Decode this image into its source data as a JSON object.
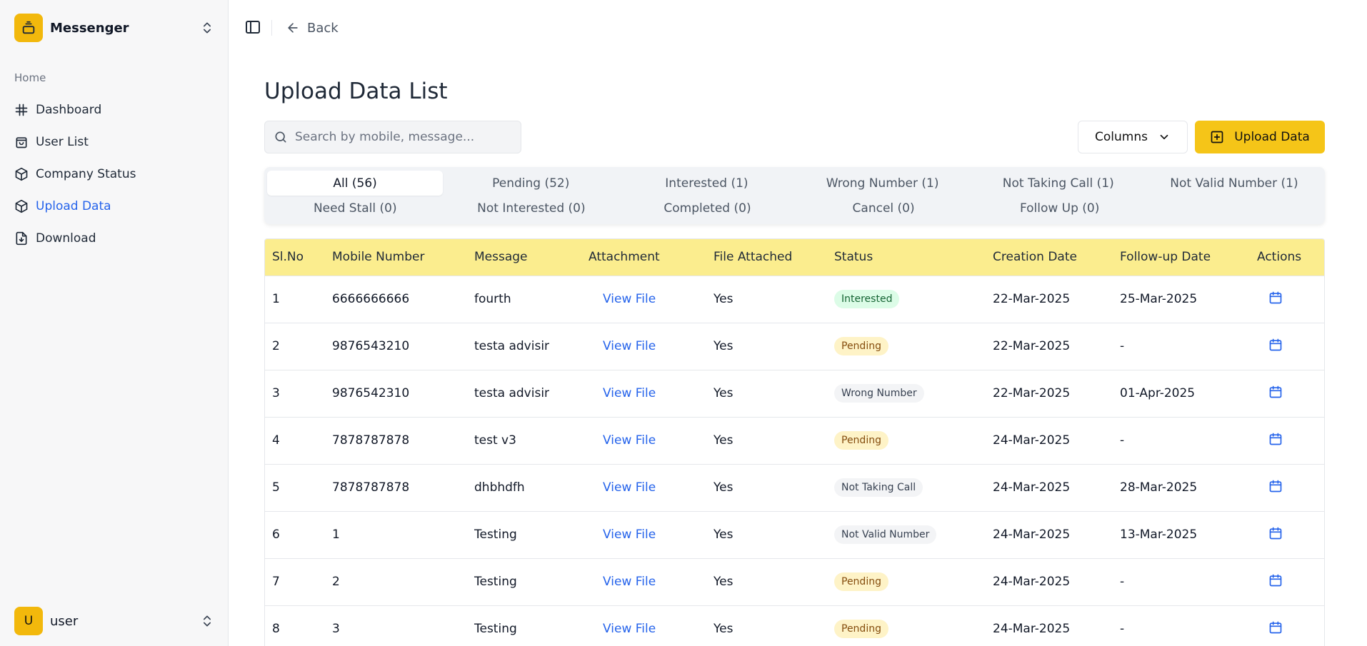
{
  "sidebar": {
    "app_name": "Messenger",
    "group_label": "Home",
    "items": [
      {
        "label": "Dashboard",
        "icon": "hash-icon"
      },
      {
        "label": "User List",
        "icon": "shopping-bag-icon"
      },
      {
        "label": "Company Status",
        "icon": "cube-icon"
      },
      {
        "label": "Upload Data",
        "icon": "cube-icon",
        "active": true
      },
      {
        "label": "Download",
        "icon": "file-download-icon"
      }
    ],
    "user": {
      "initial": "U",
      "name": "user"
    }
  },
  "topbar": {
    "back_label": "Back"
  },
  "page": {
    "title": "Upload Data List"
  },
  "search": {
    "placeholder": "Search by mobile, message..."
  },
  "toolbar": {
    "columns_label": "Columns",
    "upload_label": "Upload Data"
  },
  "tabs": [
    "All (56)",
    "Pending (52)",
    "Interested (1)",
    "Wrong Number (1)",
    "Not Taking Call (1)",
    "Not Valid Number (1)",
    "Need Stall (0)",
    "Not Interested (0)",
    "Completed (0)",
    "Cancel (0)",
    "Follow Up (0)"
  ],
  "table": {
    "headers": [
      "Sl.No",
      "Mobile Number",
      "Message",
      "Attachment",
      "File Attached",
      "Status",
      "Creation Date",
      "Follow-up Date",
      "Actions"
    ],
    "rows": [
      {
        "sl": "1",
        "mobile": "6666666666",
        "message": "fourth",
        "attachment": "View File",
        "file": "Yes",
        "status": "Interested",
        "created": "22-Mar-2025",
        "followup": "25-Mar-2025"
      },
      {
        "sl": "2",
        "mobile": "9876543210",
        "message": "testa advisir",
        "attachment": "View File",
        "file": "Yes",
        "status": "Pending",
        "created": "22-Mar-2025",
        "followup": "-"
      },
      {
        "sl": "3",
        "mobile": "9876542310",
        "message": "testa advisir",
        "attachment": "View File",
        "file": "Yes",
        "status": "Wrong Number",
        "created": "22-Mar-2025",
        "followup": "01-Apr-2025"
      },
      {
        "sl": "4",
        "mobile": "7878787878",
        "message": "test v3",
        "attachment": "View File",
        "file": "Yes",
        "status": "Pending",
        "created": "24-Mar-2025",
        "followup": "-"
      },
      {
        "sl": "5",
        "mobile": "7878787878",
        "message": "dhbhdfh",
        "attachment": "View File",
        "file": "Yes",
        "status": "Not Taking Call",
        "created": "24-Mar-2025",
        "followup": "28-Mar-2025"
      },
      {
        "sl": "6",
        "mobile": "1",
        "message": "Testing",
        "attachment": "View File",
        "file": "Yes",
        "status": "Not Valid Number",
        "created": "24-Mar-2025",
        "followup": "13-Mar-2025"
      },
      {
        "sl": "7",
        "mobile": "2",
        "message": "Testing",
        "attachment": "View File",
        "file": "Yes",
        "status": "Pending",
        "created": "24-Mar-2025",
        "followup": "-"
      },
      {
        "sl": "8",
        "mobile": "3",
        "message": "Testing",
        "attachment": "View File",
        "file": "Yes",
        "status": "Pending",
        "created": "24-Mar-2025",
        "followup": "-"
      }
    ]
  },
  "status_colors": {
    "Interested": {
      "bg": "#dcfce7",
      "fg": "#166534"
    },
    "Pending": {
      "bg": "#fef3c7",
      "fg": "#854d0e"
    },
    "Wrong Number": {
      "bg": "#f3f4f6",
      "fg": "#374151"
    },
    "Not Taking Call": {
      "bg": "#f3f4f6",
      "fg": "#374151"
    },
    "Not Valid Number": {
      "bg": "#f3f4f6",
      "fg": "#374151"
    }
  },
  "colors": {
    "accent": "#f5c518",
    "link": "#2563eb",
    "header_bg": "#fbed8e"
  }
}
